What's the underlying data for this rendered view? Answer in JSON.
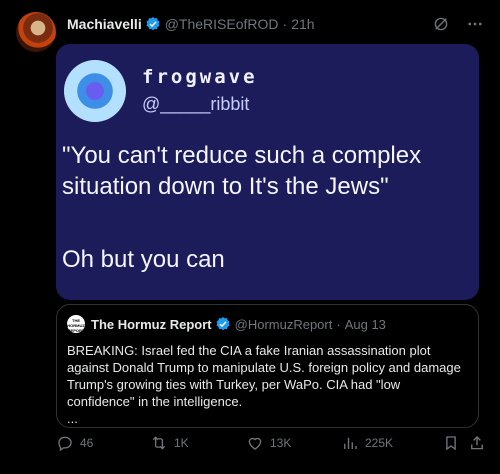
{
  "post": {
    "author": {
      "display_name": "Machiavelli",
      "handle": "@TheRISEofROD",
      "separator": "·",
      "time": "21h"
    },
    "icons": [
      "verified-icon",
      "grok-icon",
      "more-icon"
    ],
    "media": {
      "account_name": "frogwave",
      "account_handle": "@_____ribbit",
      "quote_line": "\"You can't reduce such a complex situation down to It's the Jews\"",
      "reply_line": "Oh but you can"
    },
    "quoted_post": {
      "avatar_text": "THE HORMUZ REPORT",
      "display_name": "The Hormuz Report",
      "handle": "@HormuzReport",
      "separator": "·",
      "date": "Aug 13",
      "text": "BREAKING: Israel fed the CIA a fake Iranian assassination plot against Donald Trump to manipulate U.S. foreign policy and damage Trump's growing ties with Turkey, per WaPo. CIA had \"low confidence\" in the intelligence.",
      "more": "..."
    },
    "actions": {
      "replies": "46",
      "reposts": "1K",
      "likes": "13K",
      "views": "225K"
    }
  },
  "colors": {
    "background": "#000000",
    "text": "#e7e9ea",
    "muted": "#71767b",
    "verified": "#1d9bf0",
    "media_bg": "#1c1c5a"
  }
}
